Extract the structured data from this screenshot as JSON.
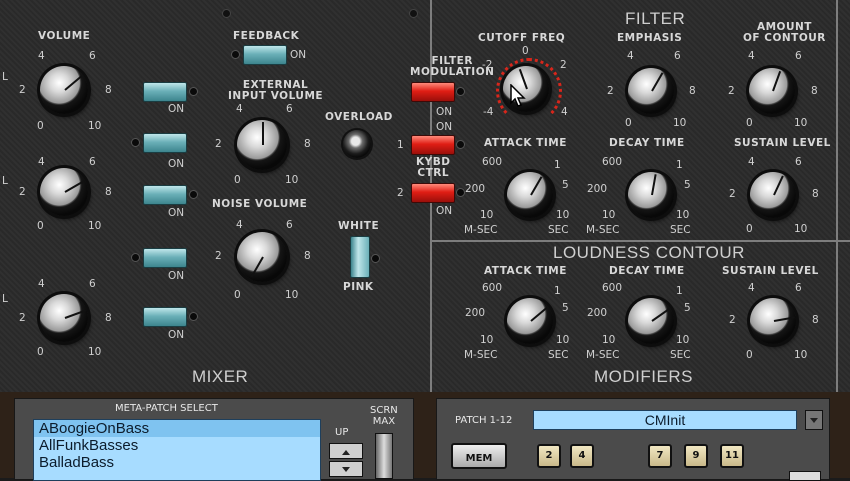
{
  "mixer": {
    "section_title": "MIXER",
    "osc_knob_label": "VOLUME",
    "knob_scale": [
      "0",
      "2",
      "4",
      "6",
      "8",
      "10"
    ],
    "on_label": "ON",
    "feedback_label": "FEEDBACK",
    "external_input_label": "EXTERNAL\nINPUT VOLUME",
    "noise_volume_label": "NOISE VOLUME",
    "overload_label": "OVERLOAD",
    "white_label": "WHITE",
    "pink_label": "PINK",
    "left_edge_letters": [
      "L",
      "L",
      "L"
    ]
  },
  "modulation": {
    "filter_modulation_label": "FILTER\nMODULATION",
    "on_label": "ON",
    "kybd_ctrl_label": "KYBD\nCTRL",
    "ctrl_numbers": [
      "1",
      "2"
    ]
  },
  "filter": {
    "section_title": "FILTER",
    "cutoff_label": "CUTOFF FREQ",
    "cutoff_scale": [
      "-4",
      "-2",
      "0",
      "2",
      "4"
    ],
    "emphasis_label": "EMPHASIS",
    "amount_label": "AMOUNT\nOF CONTOUR",
    "attack_label": "ATTACK TIME",
    "decay_label": "DECAY TIME",
    "sustain_label": "SUSTAIN LEVEL"
  },
  "loudness": {
    "section_title": "LOUDNESS CONTOUR",
    "attack_label": "ATTACK TIME",
    "decay_label": "DECAY TIME",
    "sustain_label": "SUSTAIN LEVEL"
  },
  "time_scale": {
    "t600": "600",
    "t200": "200",
    "t10": "10",
    "t1": "1",
    "t5": "5",
    "t10b": "10",
    "msec": "M-SEC",
    "sec": "SEC"
  },
  "modifiers": {
    "section_title": "MODIFIERS"
  },
  "meta_patch": {
    "title": "META-PATCH SELECT",
    "items": [
      "ABoogieOnBass",
      "AllFunkBasses",
      "BalladBass"
    ],
    "up_label": "UP",
    "scrn_max_label": "SCRN\nMAX"
  },
  "patch": {
    "label": "PATCH 1-12",
    "name": "CMInit",
    "mem_label": "MEM",
    "buttons": [
      "2",
      "4",
      "7",
      "9",
      "11"
    ]
  },
  "colors": {
    "toggle_blue": "#6bb0b8",
    "toggle_red": "#e01e15",
    "list_bg": "#a7dcff",
    "patch_name_bg": "#a7dcff"
  }
}
